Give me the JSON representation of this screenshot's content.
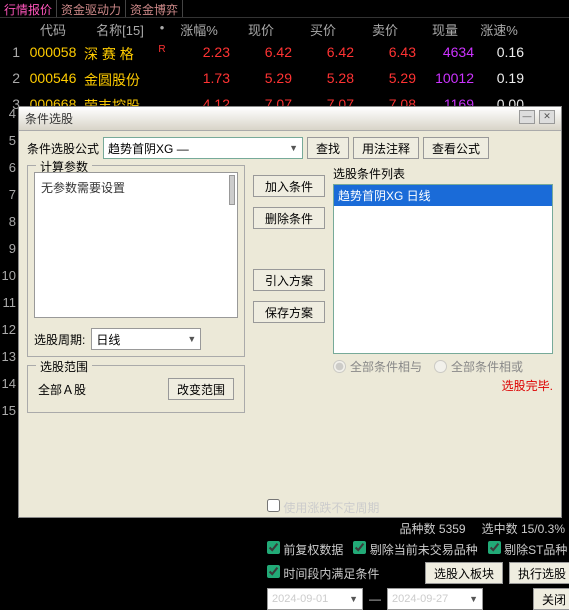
{
  "tabs": [
    "行情报价",
    "资金驱动力",
    "资金博弈"
  ],
  "table": {
    "headers": {
      "code": "代码",
      "name": "名称[15]",
      "dot": "•",
      "chg": "涨幅%",
      "price": "现价",
      "buy": "买价",
      "sell": "卖价",
      "vol": "现量",
      "spd": "涨速%"
    },
    "rows": [
      {
        "idx": "1",
        "code": "000058",
        "name": "深 赛 格",
        "mark": "R",
        "chg": "2.23",
        "price": "6.42",
        "buy": "6.42",
        "sell": "6.43",
        "vol": "4634",
        "spd": "0.16"
      },
      {
        "idx": "2",
        "code": "000546",
        "name": "金圆股份",
        "mark": "",
        "chg": "1.73",
        "price": "5.29",
        "buy": "5.28",
        "sell": "5.29",
        "vol": "10012",
        "spd": "0.19"
      },
      {
        "idx": "3",
        "code": "000668",
        "name": "荣丰控股",
        "mark": "",
        "chg": "4.12",
        "price": "7.07",
        "buy": "7.07",
        "sell": "7.08",
        "vol": "1169",
        "spd": "0.00"
      }
    ]
  },
  "rowNumbers": [
    "4",
    "5",
    "6",
    "7",
    "8",
    "9",
    "10",
    "11",
    "12",
    "13",
    "14",
    "15"
  ],
  "dialog": {
    "title": "条件选股",
    "formula_label": "条件选股公式",
    "formula_value": "趋势首阴XG  —",
    "btn_search": "查找",
    "btn_usage": "用法注释",
    "btn_viewformula": "查看公式",
    "params_legend": "计算参数",
    "params_text": "无参数需要设置",
    "period_label": "选股周期:",
    "period_value": "日线",
    "btn_add": "加入条件",
    "btn_del": "删除条件",
    "btn_import": "引入方案",
    "btn_save": "保存方案",
    "list_legend": "选股条件列表",
    "list_item": "趋势首阴XG  日线",
    "radio_and": "全部条件相与",
    "radio_or": "全部条件相或",
    "done_text": "选股完毕.",
    "range_legend": "选股范围",
    "range_value": "全部Ａ股",
    "btn_changerange": "改变范围",
    "chk_undef_period": "使用涨跌不定周期",
    "stats_kind_label": "品种数",
    "stats_kind_value": "5359",
    "stats_sel_label": "选中数",
    "stats_sel_value": "15/0.3%",
    "chk_fq": "前复权数据",
    "chk_exnew": "剔除当前未交易品种",
    "chk_exst": "剔除ST品种",
    "chk_timerange": "时间段内满足条件",
    "btn_toblock": "选股入板块",
    "btn_exec": "执行选股",
    "date_from": "2024-09-01",
    "date_to": "2024-09-27",
    "btn_close": "关闭"
  }
}
